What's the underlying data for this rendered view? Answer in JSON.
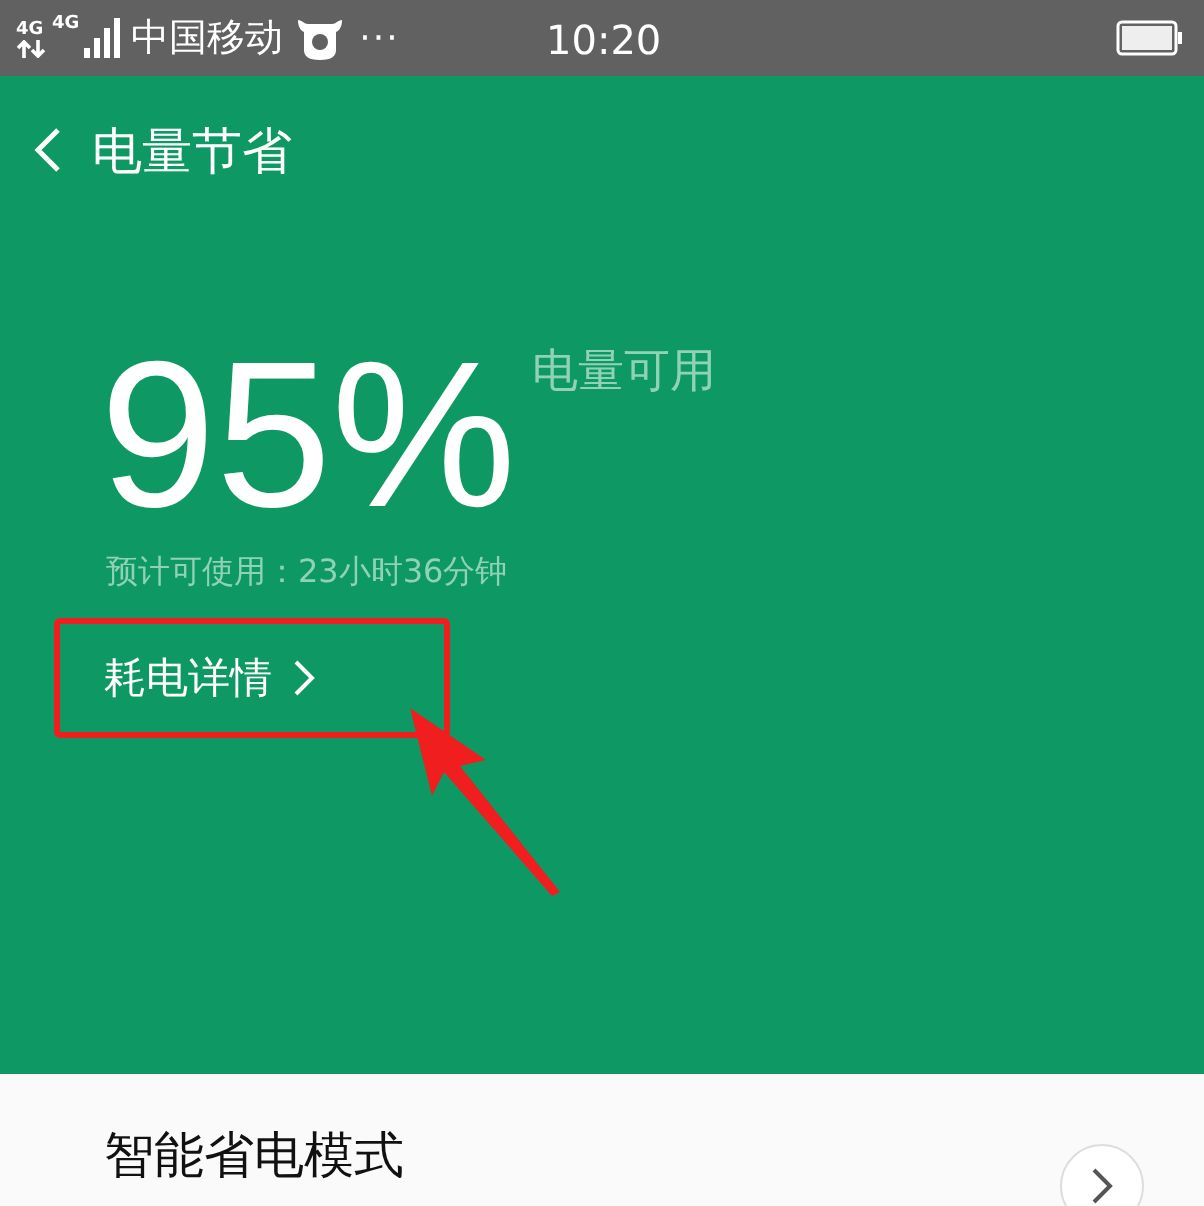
{
  "status_bar": {
    "network_1": "4G",
    "network_2": "4G",
    "carrier": "中国移动",
    "more": "···",
    "time": "10:20"
  },
  "header": {
    "title": "电量节省"
  },
  "battery": {
    "percent": "95%",
    "caption": "电量可用",
    "estimate": "预计可使用：23小时36分钟",
    "details_link": "耗电详情"
  },
  "settings": [
    {
      "title": "智能省电模式"
    }
  ]
}
